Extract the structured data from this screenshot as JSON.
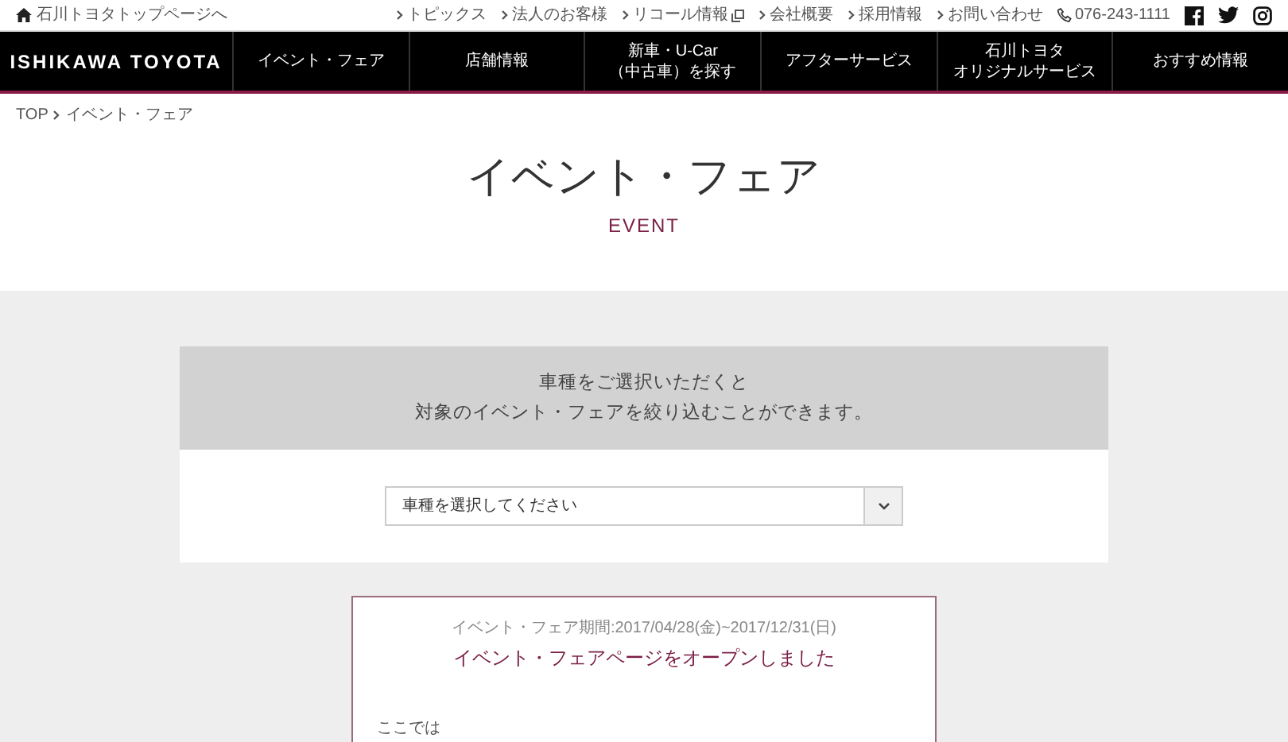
{
  "top_bar": {
    "home_link": "石川トヨタトップページへ",
    "links": [
      {
        "label": "トピックス",
        "external": false
      },
      {
        "label": "法人のお客様",
        "external": false
      },
      {
        "label": "リコール情報",
        "external": true
      },
      {
        "label": "会社概要",
        "external": false
      },
      {
        "label": "採用情報",
        "external": false
      },
      {
        "label": "お問い合わせ",
        "external": false
      }
    ],
    "phone": "076-243-1111"
  },
  "nav": {
    "logo": "ISHIKAWA TOYOTA",
    "items": [
      {
        "lines": [
          "イベント・フェア"
        ]
      },
      {
        "lines": [
          "店舗情報"
        ]
      },
      {
        "lines": [
          "新車・U-Car",
          "（中古車）を探す"
        ]
      },
      {
        "lines": [
          "アフターサービス"
        ]
      },
      {
        "lines": [
          "石川トヨタ",
          "オリジナルサービス"
        ]
      },
      {
        "lines": [
          "おすすめ情報"
        ]
      }
    ]
  },
  "breadcrumb": [
    "TOP",
    "イベント・フェア"
  ],
  "heading": {
    "title": "イベント・フェア",
    "subtitle": "EVENT"
  },
  "filter": {
    "lines": [
      "車種をご選択いただくと",
      "対象のイベント・フェアを絞り込むことができます。"
    ],
    "select": {
      "placeholder": "車種を選択してください"
    }
  },
  "event_card": {
    "period": "イベント・フェア期間:2017/04/28(金)~2017/12/31(日)",
    "title": "イベント・フェアページをオープンしました",
    "body": "ここでは"
  }
}
